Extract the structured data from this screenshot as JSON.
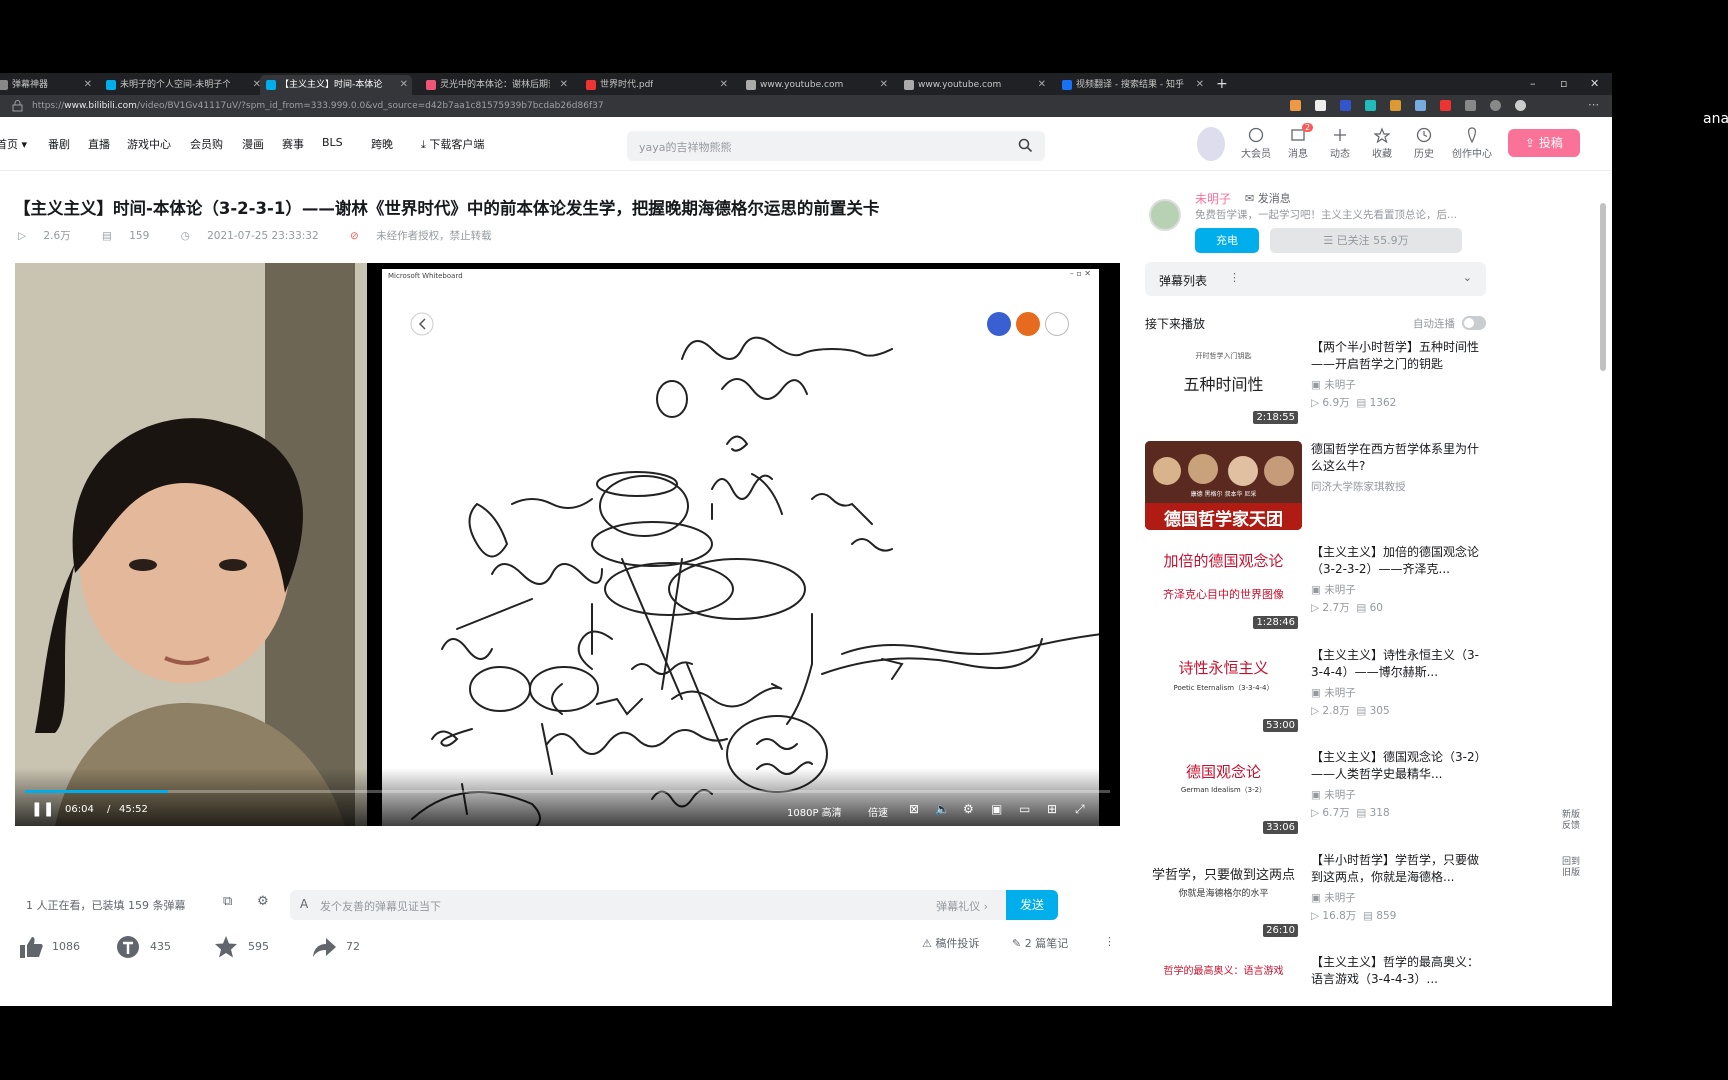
{
  "browser": {
    "tabs": [
      {
        "label": "弹幕神器",
        "color": "#888"
      },
      {
        "label": "未明子的个人空间-未明子个人主页",
        "color": "#00aeec"
      },
      {
        "label": "【主义主义】时间-本体论",
        "color": "#00aeec"
      },
      {
        "label": "灵光中的本体论：谢林后期哲学",
        "color": "#e57"
      },
      {
        "label": "世界时代.pdf",
        "color": "#e33"
      },
      {
        "label": "www.youtube.com",
        "color": "#aaa"
      },
      {
        "label": "www.youtube.com",
        "color": "#aaa"
      },
      {
        "label": "视频翻译 - 搜索结果 - 知乎",
        "color": "#1772f6"
      }
    ],
    "url_prefix": "https://",
    "url_host": "www.bilibili.com",
    "url_path": "/video/BV1Gv41117uV/?spm_id_from=333.999.0.0&vd_source=d42b7aa1c81575939b7bcdab26d86f37",
    "window_controls": [
      "–",
      "▫",
      "✕"
    ]
  },
  "header": {
    "nav": [
      "首页 ▾",
      "番剧",
      "直播",
      "游戏中心",
      "会员购",
      "漫画",
      "赛事",
      "BLS",
      "跨晚",
      "下载客户端"
    ],
    "search_placeholder": "yaya的吉祥物熊熊",
    "icons": [
      {
        "label": "大会员",
        "icon": "vip-icon"
      },
      {
        "label": "消息",
        "icon": "message-icon",
        "badge": "2"
      },
      {
        "label": "动态",
        "icon": "dynamic-icon"
      },
      {
        "label": "收藏",
        "icon": "favorite-icon"
      },
      {
        "label": "历史",
        "icon": "history-icon"
      },
      {
        "label": "创作中心",
        "icon": "creator-icon"
      }
    ],
    "upload": "投稿"
  },
  "video": {
    "title": "【主义主义】时间-本体论（3-2-3-1）——谢林《世界时代》中的前本体论发生学，把握晚期海德格尔运思的前置关卡",
    "views": "2.6万",
    "danmaku_count": "159",
    "date": "2021-07-25 23:33:32",
    "copyright": "未经作者授权，禁止转载",
    "whiteboard_title": "Microsoft Whiteboard",
    "time_current": "06:04",
    "time_total": "45:52",
    "progress": 0.132,
    "quality": "1080P 高清",
    "speed": "倍速"
  },
  "danmaku_bar": {
    "watching": "1 人正在看，已装填 159 条弹幕",
    "placeholder": "发个友善的弹幕见证当下",
    "etiquette": "弹幕礼仪 ›",
    "send": "发送"
  },
  "actions": {
    "like": "1086",
    "coin": "435",
    "favorite": "595",
    "share": "72",
    "report": "稿件投诉",
    "notes": "2 篇笔记"
  },
  "uploader": {
    "name": "未明子",
    "message": "发消息",
    "desc": "免费哲学课，一起学习吧！主义主义先看置顶总论，后...",
    "charge": "充电",
    "follow": "已关注 55.9万"
  },
  "sidebar": {
    "danmaku_list": "弹幕列表",
    "next_up": "接下来播放",
    "autoplay": "自动连播",
    "recs": [
      {
        "title": "【两个半小时哲学】五种时间性——开启哲学之门的钥匙",
        "up": "未明子",
        "views": "6.9万",
        "dm": "1362",
        "dur": "2:18:55",
        "thumb": "五种时间性",
        "thumb_sub": "开时哲学入门钥匙"
      },
      {
        "title": "德国哲学在西方哲学体系里为什么这么牛?",
        "up": "同济大学陈家琪教授",
        "views": "",
        "dm": "",
        "dur": "",
        "thumb": "德国哲学家天团",
        "thumb_sub": "康德  黑格尔  叔本华  尼采"
      },
      {
        "title": "【主义主义】加倍的德国观念论（3-2-3-2）——齐泽克...",
        "up": "未明子",
        "views": "2.7万",
        "dm": "60",
        "dur": "1:28:46",
        "thumb": "加倍的德国观念论",
        "thumb_sub": "齐泽克心目中的世界图像"
      },
      {
        "title": "【主义主义】诗性永恒主义（3-3-4-4）——博尔赫斯...",
        "up": "未明子",
        "views": "2.8万",
        "dm": "305",
        "dur": "53:00",
        "thumb": "诗性永恒主义",
        "thumb_sub": "Poetic Eternalism（3-3-4-4）"
      },
      {
        "title": "【主义主义】德国观念论（3-2）——人类哲学史最精华...",
        "up": "未明子",
        "views": "6.7万",
        "dm": "318",
        "dur": "33:06",
        "thumb": "德国观念论",
        "thumb_sub": "German Idealism（3-2）"
      },
      {
        "title": "【半小时哲学】学哲学，只要做到这两点，你就是海德格...",
        "up": "未明子",
        "views": "16.8万",
        "dm": "859",
        "dur": "26:10",
        "thumb": "学哲学，只要做到这两点",
        "thumb_sub": "你就是海德格尔的水平"
      },
      {
        "title": "【主义主义】哲学的最高奥义：语言游戏（3-4-4-3）...",
        "up": "",
        "views": "",
        "dm": "",
        "dur": "",
        "thumb": "哲学的最高奥义：语言游戏",
        "thumb_sub": ""
      }
    ],
    "feedback": "新版反馈",
    "back_old": "回到旧版"
  },
  "overlay_text": "ana"
}
